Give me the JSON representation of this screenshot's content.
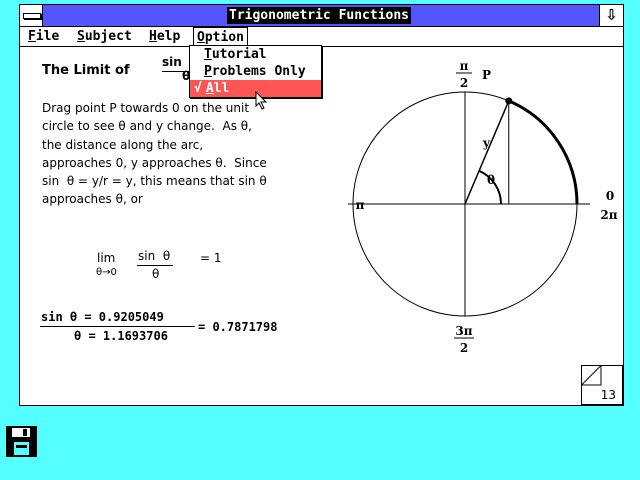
{
  "window": {
    "title": "Trigonometric Functions",
    "maximize_glyph": "⇩"
  },
  "menubar": {
    "file": {
      "accel": "F",
      "rest": "ile"
    },
    "subject": {
      "accel": "S",
      "rest": "ubject"
    },
    "help": {
      "accel": "H",
      "rest": "elp"
    },
    "option": {
      "accel": "O",
      "rest": "ption"
    }
  },
  "option_menu": {
    "items": [
      {
        "accel": "T",
        "rest": "utorial",
        "checked": false,
        "selected": false
      },
      {
        "accel": "P",
        "rest": "roblems Only",
        "checked": false,
        "selected": false
      },
      {
        "accel": "A",
        "rest": "ll",
        "check": "√",
        "checked": true,
        "selected": true
      }
    ]
  },
  "lesson": {
    "heading": "The Limit of",
    "heading_frac_num": "sin",
    "heading_frac_den": "θ",
    "paragraph": [
      "Drag point P towards 0 on the unit",
      "circle to see θ and y change.  As θ,",
      "the distance along the arc,",
      "approaches 0, y approaches θ.  Since",
      "sin  θ = y/r = y, this means that sin θ",
      "approaches θ, or"
    ],
    "limit": {
      "lim": "lim",
      "sub": "θ→0",
      "num": "sin  θ",
      "den": "θ",
      "equals": "= 1"
    },
    "computation": {
      "numerator": "sin θ = 0.9205049",
      "denominator": "θ = 1.1693706",
      "result": "= 0.7871798"
    }
  },
  "circle_diagram": {
    "label_top_num": "π",
    "label_top_den": "2",
    "label_left": "π",
    "label_right_zero": "0",
    "label_right_two_pi": "2π",
    "label_bottom_num": "3π",
    "label_bottom_den": "2",
    "point_label": "P",
    "y_label": "y",
    "theta_label": "θ",
    "theta": 1.1693706
  },
  "page": {
    "number": "13"
  }
}
